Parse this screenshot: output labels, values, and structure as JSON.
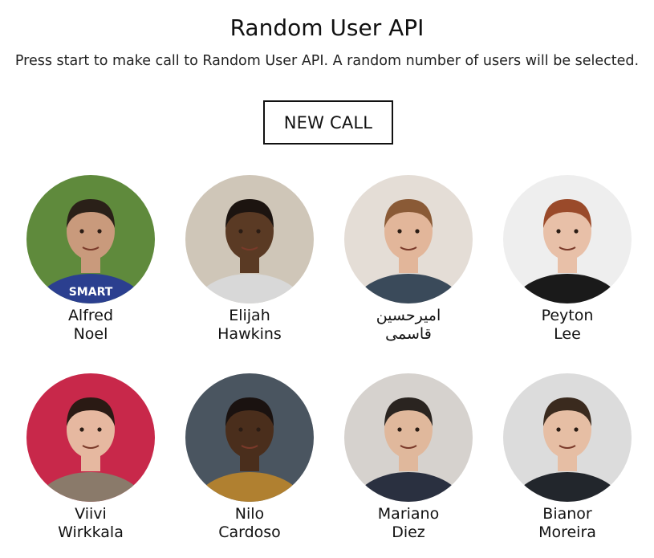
{
  "header": {
    "title": "Random User API",
    "subtitle": "Press start to make call to Random User API. A random number of users will be selected.",
    "button_label": "NEW CALL"
  },
  "users": [
    {
      "first": "Alfred",
      "last": "Noel",
      "shirt_text": "SMART",
      "colors": {
        "bg": "#5f8a3c",
        "skin": "#c99a7c",
        "hair": "#2a2018",
        "clothing": "#2b3f8f"
      }
    },
    {
      "first": "Elijah",
      "last": "Hawkins",
      "colors": {
        "bg": "#cfc6b8",
        "skin": "#5a3a24",
        "hair": "#1c1410",
        "clothing": "#d8d8d8"
      }
    },
    {
      "first": "امیرحسین",
      "last": "قاسمی",
      "colors": {
        "bg": "#e4ddd6",
        "skin": "#e2b69a",
        "hair": "#8a5a36",
        "clothing": "#3a4a5a"
      }
    },
    {
      "first": "Peyton",
      "last": "Lee",
      "colors": {
        "bg": "#eeeeee",
        "skin": "#e8c0a8",
        "hair": "#9a4a2a",
        "clothing": "#1a1a1a"
      }
    },
    {
      "first": "Viivi",
      "last": "Wirkkala",
      "colors": {
        "bg": "#c8284a",
        "skin": "#e6b8a0",
        "hair": "#2a1a14",
        "clothing": "#8a7a6a"
      }
    },
    {
      "first": "Nilo",
      "last": "Cardoso",
      "colors": {
        "bg": "#4a5560",
        "skin": "#4a2e1c",
        "hair": "#1a1210",
        "clothing": "#b08030"
      }
    },
    {
      "first": "Mariano",
      "last": "Diez",
      "colors": {
        "bg": "#d6d2ce",
        "skin": "#e0b89c",
        "hair": "#2a2420",
        "clothing": "#2a3040"
      }
    },
    {
      "first": "Bianor",
      "last": "Moreira",
      "colors": {
        "bg": "#dcdcdc",
        "skin": "#e6bea4",
        "hair": "#3a2a1e",
        "clothing": "#22262c"
      }
    }
  ]
}
